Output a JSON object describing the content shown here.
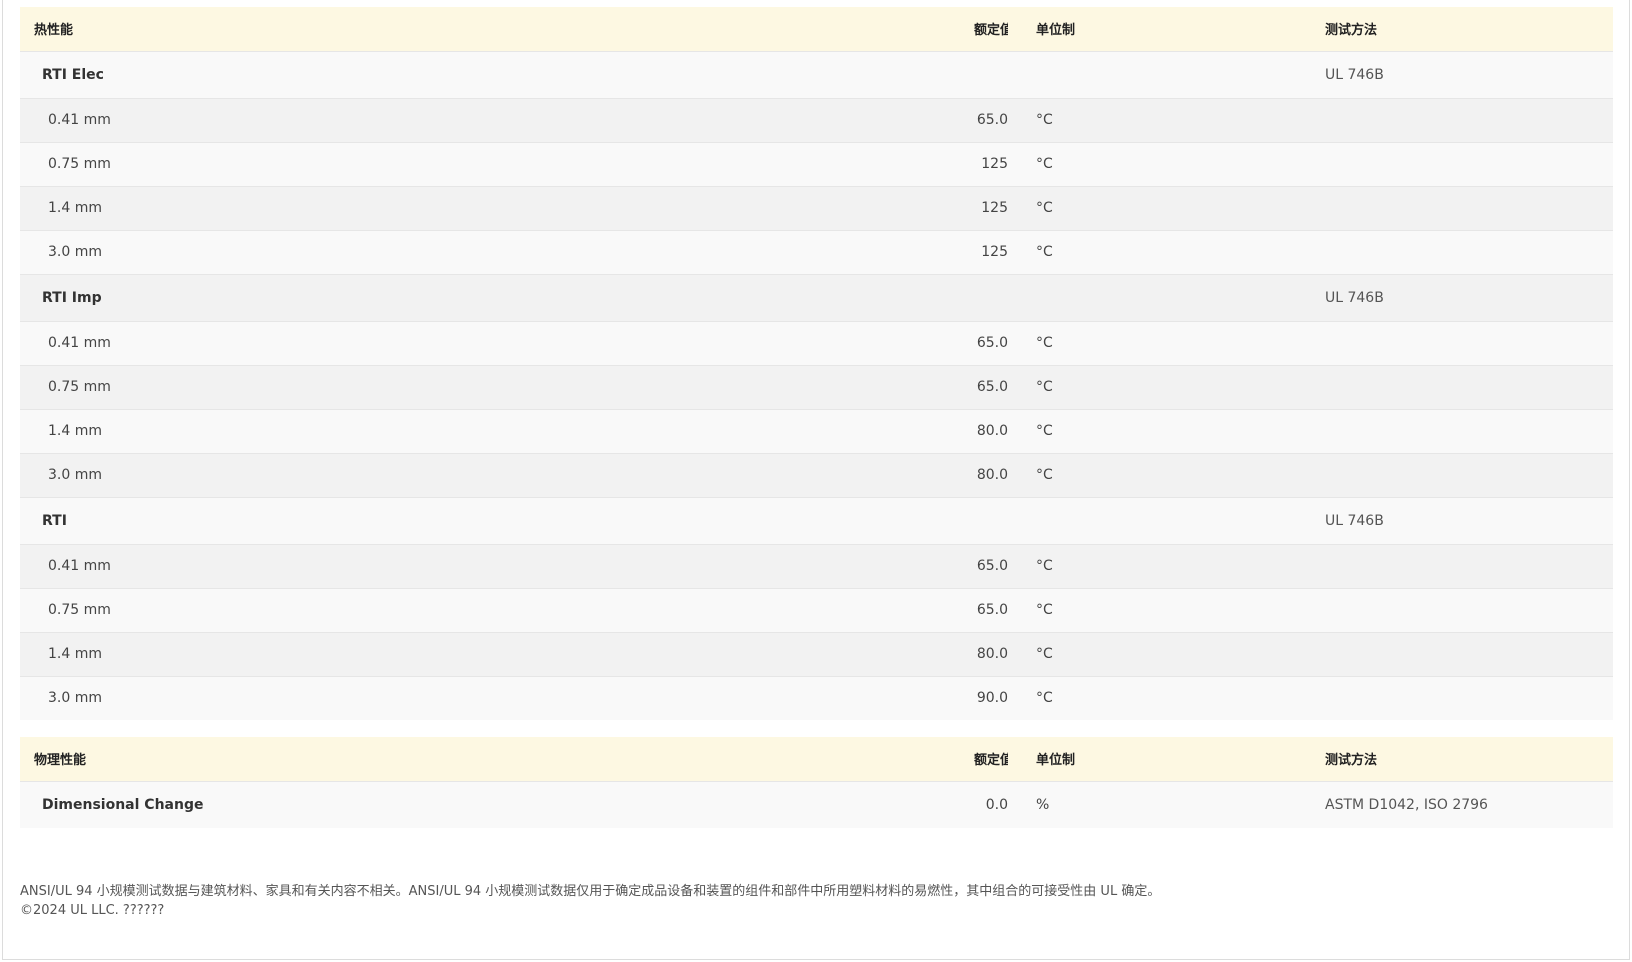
{
  "thermal": {
    "header": {
      "name": "热性能",
      "value": "额定值",
      "unit": "单位制",
      "test": "测试方法"
    },
    "groups": [
      {
        "name": "RTI Elec",
        "test": "UL 746B",
        "rows": [
          {
            "name": "0.41 mm",
            "value": "65.0",
            "unit": "°C"
          },
          {
            "name": "0.75 mm",
            "value": "125",
            "unit": "°C"
          },
          {
            "name": "1.4 mm",
            "value": "125",
            "unit": "°C"
          },
          {
            "name": "3.0 mm",
            "value": "125",
            "unit": "°C"
          }
        ]
      },
      {
        "name": "RTI Imp",
        "test": "UL 746B",
        "rows": [
          {
            "name": "0.41 mm",
            "value": "65.0",
            "unit": "°C"
          },
          {
            "name": "0.75 mm",
            "value": "65.0",
            "unit": "°C"
          },
          {
            "name": "1.4 mm",
            "value": "80.0",
            "unit": "°C"
          },
          {
            "name": "3.0 mm",
            "value": "80.0",
            "unit": "°C"
          }
        ]
      },
      {
        "name": "RTI",
        "test": "UL 746B",
        "rows": [
          {
            "name": "0.41 mm",
            "value": "65.0",
            "unit": "°C"
          },
          {
            "name": "0.75 mm",
            "value": "65.0",
            "unit": "°C"
          },
          {
            "name": "1.4 mm",
            "value": "80.0",
            "unit": "°C"
          },
          {
            "name": "3.0 mm",
            "value": "90.0",
            "unit": "°C"
          }
        ]
      }
    ]
  },
  "physical": {
    "header": {
      "name": "物理性能",
      "value": "额定值",
      "unit": "单位制",
      "test": "测试方法"
    },
    "rows": [
      {
        "name": "Dimensional Change",
        "value": "0.0",
        "unit": "%",
        "test": "ASTM D1042, ISO 2796"
      }
    ]
  },
  "footer": {
    "disclaimer": "ANSI/UL 94 小规模测试数据与建筑材料、家具和有关内容不相关。ANSI/UL 94 小规模测试数据仅用于确定成品设备和装置的组件和部件中所用塑料材料的易燃性，其中组合的可接受性由 UL 确定。",
    "copyright": "©2024 UL LLC. ??????"
  }
}
